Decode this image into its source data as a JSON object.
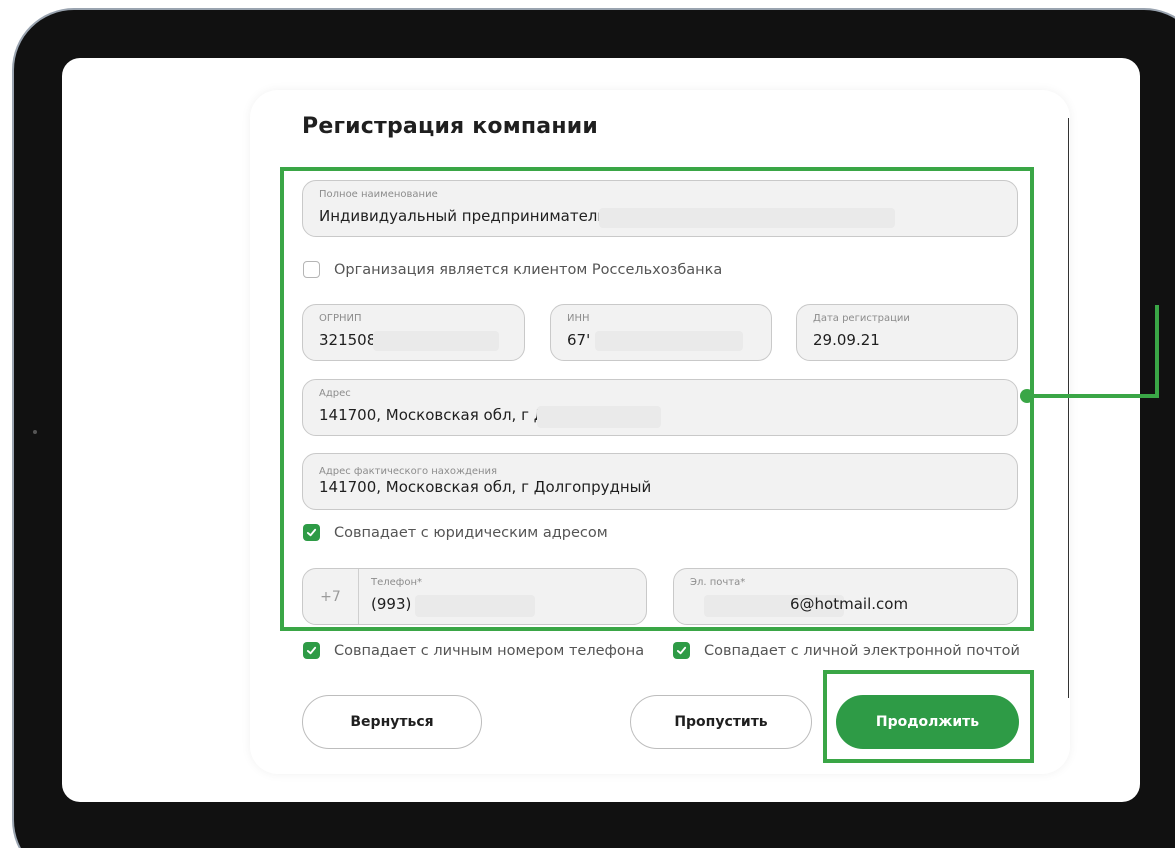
{
  "form": {
    "title": "Регистрация компании",
    "full_name": {
      "label": "Полное наименование",
      "value": "Индивидуальный предприниматель"
    },
    "client_checkbox": {
      "label": "Организация является клиентом Россельхозбанка",
      "checked": false
    },
    "ogrnip": {
      "label": "ОГРНИП",
      "value": "321508"
    },
    "inn": {
      "label": "ИНН",
      "value": "67'"
    },
    "reg_date": {
      "label": "Дата регистрации",
      "value": "29.09.21"
    },
    "address": {
      "label": "Адрес",
      "value": "141700, Московская обл, г Д"
    },
    "actual_address": {
      "label": "Адрес фактического нахождения",
      "value": "141700, Московская обл, г Долгопрудный"
    },
    "same_legal_checkbox": {
      "label": "Совпадает с юридическим адресом",
      "checked": true
    },
    "phone": {
      "prefix": "+7",
      "label": "Телефон*",
      "value": "(993)"
    },
    "email": {
      "label": "Эл. почта*",
      "value": "6@hotmail.com"
    },
    "same_phone_checkbox": {
      "label": "Совпадает с личным номером телефона",
      "checked": true
    },
    "same_email_checkbox": {
      "label": "Совпадает с личной электронной почтой",
      "checked": true
    }
  },
  "buttons": {
    "back": "Вернуться",
    "skip": "Пропустить",
    "continue": "Продолжить"
  },
  "colors": {
    "accent": "#2e9b46",
    "highlight": "#3aa646"
  },
  "icons": {
    "checkbox_checked": "check-icon"
  }
}
